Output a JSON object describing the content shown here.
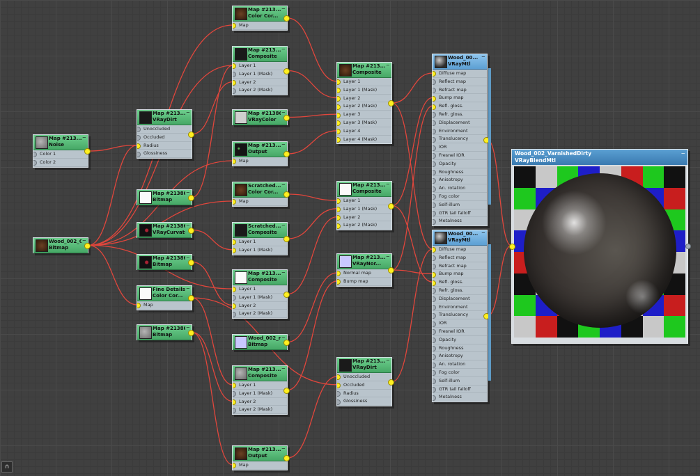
{
  "nodes": {
    "n_noise": {
      "t1": "Map #213...",
      "t2": "Noise",
      "thumb": "th-noise",
      "rows": [
        "Color 1",
        "Color 2"
      ]
    },
    "n_wood": {
      "t1": "Wood_002_C...",
      "t2": "Bitmap",
      "thumb": "th-brown",
      "rows": []
    },
    "n_vraydirt1": {
      "t1": "Map #213...",
      "t2": "VRayDirt",
      "thumb": "th-dark",
      "rows": [
        "Unoccluded",
        "Occluded",
        "Radius",
        "Glossiness"
      ]
    },
    "n_bitmap1": {
      "t1": "Map #213862...",
      "t2": "Bitmap",
      "thumb": "th-white",
      "rows": []
    },
    "n_vraycurv": {
      "t1": "Map #213862...",
      "t2": "VRayCurvature",
      "thumb": "th-redd",
      "rows": []
    },
    "n_bitmap2": {
      "t1": "Map #213862...",
      "t2": "Bitmap",
      "thumb": "th-redd",
      "rows": []
    },
    "n_finedet": {
      "t1": "Fine Details",
      "t2": "Color Cor...",
      "thumb": "th-white",
      "rows": [
        "Map"
      ]
    },
    "n_bitmap3": {
      "t1": "Map #213862...",
      "t2": "Bitmap",
      "thumb": "th-noise",
      "rows": []
    },
    "n_colorcor1": {
      "t1": "Map #213...",
      "t2": "Color Cor...",
      "thumb": "th-brown",
      "rows": [
        "Map"
      ]
    },
    "n_comp1": {
      "t1": "Map #213...",
      "t2": "Composite",
      "thumb": "th-dark",
      "rows": [
        "Layer 1",
        "Layer 1 (Mask)",
        "Layer 2",
        "Layer 2 (Mask)"
      ]
    },
    "n_vraycolor": {
      "t1": "Map #213862...",
      "t2": "VRayColor",
      "thumb": "th-grey",
      "rows": []
    },
    "n_output1": {
      "t1": "Map #213...",
      "t2": "Output",
      "thumb": "th-dots",
      "rows": [
        "Map"
      ]
    },
    "n_scratchcc": {
      "t1": "Scratched...",
      "t2": "Color Cor...",
      "thumb": "th-brown",
      "rows": [
        "Map"
      ]
    },
    "n_scratchcomp": {
      "t1": "Scratched...",
      "t2": "Composite",
      "thumb": "th-dark",
      "rows": [
        "Layer 1",
        "Layer 1 (Mask)"
      ]
    },
    "n_comp2": {
      "t1": "Map #213...",
      "t2": "Composite",
      "thumb": "th-white",
      "rows": [
        "Layer 1",
        "Layer 1 (Mask)",
        "Layer 2",
        "Layer 2 (Mask)"
      ]
    },
    "n_woodn": {
      "t1": "Wood_002_n...",
      "t2": "Bitmap",
      "thumb": "th-lav",
      "rows": []
    },
    "n_comp3": {
      "t1": "Map #213...",
      "t2": "Composite",
      "thumb": "th-noise",
      "rows": [
        "Layer 1",
        "Layer 1 (Mask)",
        "Layer 2",
        "Layer 2 (Mask)"
      ]
    },
    "n_output2": {
      "t1": "Map #213...",
      "t2": "Output",
      "thumb": "th-brown",
      "rows": [
        "Map"
      ]
    },
    "n_comp4": {
      "t1": "Map #213...",
      "t2": "Composite",
      "thumb": "th-brown",
      "rows": [
        "Layer 1",
        "Layer 1 (Mask)",
        "Layer 2",
        "Layer 2 (Mask)",
        "Layer 3",
        "Layer 3 (Mask)",
        "Layer 4",
        "Layer 4 (Mask)"
      ]
    },
    "n_comp5": {
      "t1": "Map #213...",
      "t2": "Composite",
      "thumb": "th-white",
      "rows": [
        "Layer 1",
        "Layer 1 (Mask)",
        "Layer 2",
        "Layer 2 (Mask)"
      ]
    },
    "n_vraynorm": {
      "t1": "Map #213...",
      "t2": "VRayNor...",
      "thumb": "th-lav",
      "rows": [
        "Normal map",
        "Bump map"
      ]
    },
    "n_vraydirt2": {
      "t1": "Map #213...",
      "t2": "VRayDirt",
      "thumb": "th-dark",
      "rows": [
        "Unoccluded",
        "Occluded",
        "Radius",
        "Glossiness"
      ]
    },
    "n_mtl1": {
      "t1": "Wood_00...",
      "t2": "VRayMtl",
      "thumb": "th-ball",
      "rows": [
        "Diffuse map",
        "Reflect map",
        "Refract map",
        "Bump map",
        "Refl. gloss.",
        "Refr. gloss.",
        "Displacement",
        "Environment",
        "Translucency",
        "IOR",
        "Fresnel IOR",
        "Opacity",
        "Roughness",
        "Anisotropy",
        "An. rotation",
        "Fog color",
        "Self-illum",
        "GTR tail falloff",
        "Metalness"
      ]
    },
    "n_mtl2": {
      "t1": "Wood_00...",
      "t2": "VRayMtl",
      "thumb": "th-ball",
      "rows": [
        "Diffuse map",
        "Reflect map",
        "Refract map",
        "Bump map",
        "Refl. gloss.",
        "Refr. gloss.",
        "Displacement",
        "Environment",
        "Translucency",
        "IOR",
        "Fresnel IOR",
        "Opacity",
        "Roughness",
        "Anisotropy",
        "An. rotation",
        "Fog color",
        "Self-illum",
        "GTR tail falloff",
        "Metalness"
      ]
    }
  },
  "blend": {
    "title": "Wood_002_VarnishedDirty",
    "type": "VRayBlendMtl",
    "minimize": "─"
  },
  "minimize_glyph": "─",
  "checker_colors": [
    "#111111",
    "#c8c8c8",
    "#c81e1e",
    "#1ec81e",
    "#1e1ec8"
  ],
  "wire_color": "#e0463c",
  "corner_icon": "lock-icon",
  "corner_glyph": "∩"
}
